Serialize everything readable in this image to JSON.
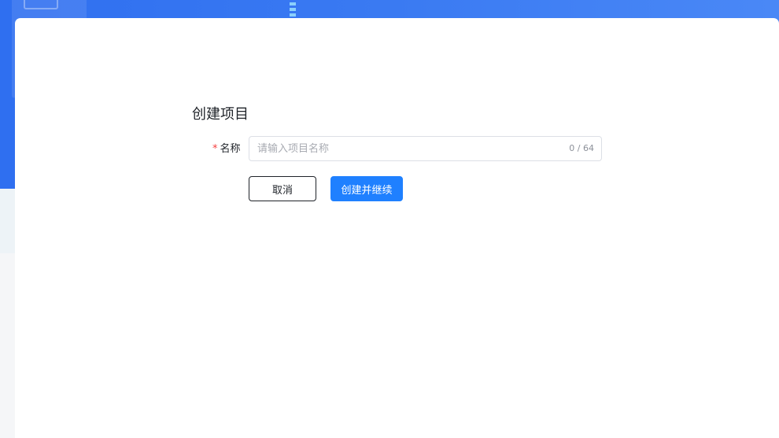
{
  "form": {
    "title": "创建项目",
    "name_field": {
      "required_mark": "*",
      "label": "名称",
      "placeholder": "请输入项目名称",
      "value": "",
      "counter": "0 / 64"
    }
  },
  "buttons": {
    "cancel_label": "取消",
    "submit_label": "创建并继续"
  },
  "colors": {
    "accent": "#1f80ff",
    "banner": "#3a7af2",
    "required": "#f53f3f"
  }
}
